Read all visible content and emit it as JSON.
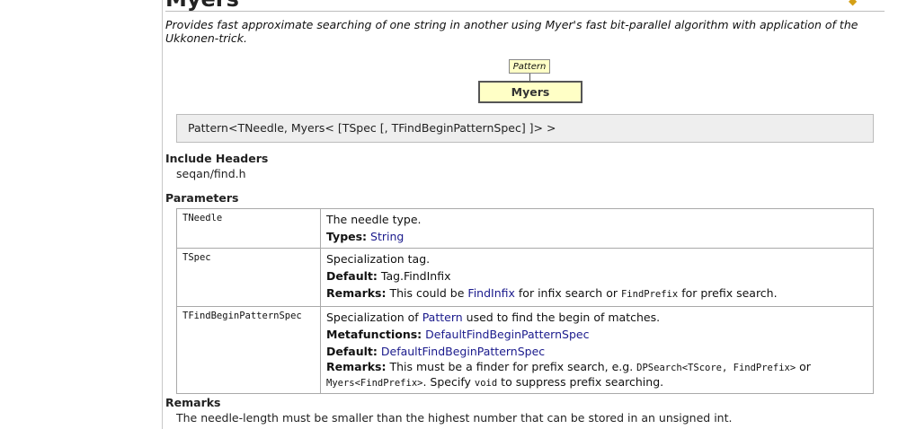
{
  "title": "Myers",
  "summary": "Provides fast approximate searching of one string in another using Myer's fast bit-parallel algorithm with application of the Ukkonen-trick.",
  "diagram": {
    "parent": "Pattern",
    "child": "Myers"
  },
  "signature": "Pattern<TNeedle, Myers< [TSpec [, TFindBeginPatternSpec] ]> >",
  "include": {
    "heading": "Include Headers",
    "path": "seqan/find.h"
  },
  "parameters": {
    "heading": "Parameters",
    "tneedle": {
      "name": "TNeedle",
      "desc": "The needle type.",
      "types_label": "Types:",
      "types_link": "String"
    },
    "tspec": {
      "name": "TSpec",
      "desc": "Specialization tag.",
      "default_label": "Default:",
      "default_value": "Tag.FindInfix",
      "remarks_label": "Remarks:",
      "remarks_pre": "This could be",
      "remarks_link": "FindInfix",
      "remarks_mid": "for infix search or",
      "remarks_code": "FindPrefix",
      "remarks_post": "for prefix search."
    },
    "tfind": {
      "name": "TFindBeginPatternSpec",
      "desc_pre": "Specialization of",
      "desc_link": "Pattern",
      "desc_post": "used to find the begin of matches.",
      "meta_label": "Metafunctions:",
      "meta_link": "DefaultFindBeginPatternSpec",
      "default_label": "Default:",
      "default_link": "DefaultFindBeginPatternSpec",
      "remarks_label": "Remarks:",
      "remarks_pre": "This must be a finder for prefix search, e.g.",
      "remarks_code1": "DPSearch<TScore, FindPrefix>",
      "remarks_or": "or",
      "remarks_code2": "Myers<FindPrefix>",
      "remarks_mid": ". Specify",
      "remarks_code3": "void",
      "remarks_post": "to suppress prefix searching."
    }
  },
  "remarks": {
    "heading": "Remarks",
    "text": "The needle-length must be smaller than the highest number that can be stored in an unsigned int."
  }
}
